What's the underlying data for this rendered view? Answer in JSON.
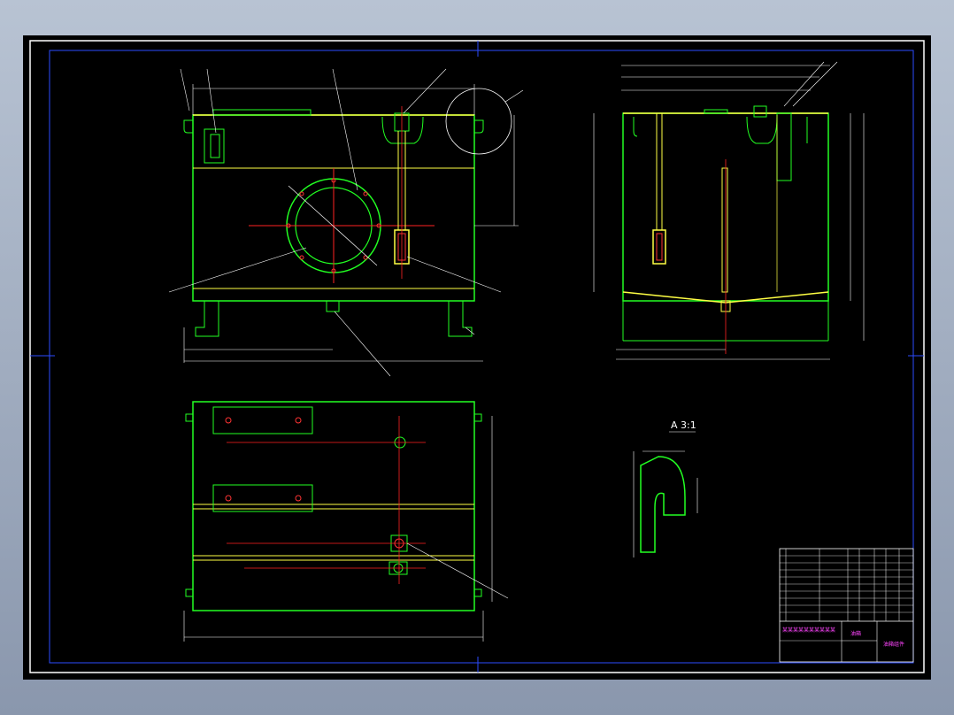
{
  "section_label": "A 3:1",
  "title_block": {
    "name": "油箱",
    "drawing_no": "油箱组件",
    "company": "某某某某某某某某某某"
  },
  "colors": {
    "background": "#000000",
    "outline": "#00ff00",
    "centerline": "#ff0000",
    "dimension": "#ffffff",
    "frame": "#0000ff",
    "hidden": "#ffff00",
    "title_text": "#ff00ff"
  }
}
